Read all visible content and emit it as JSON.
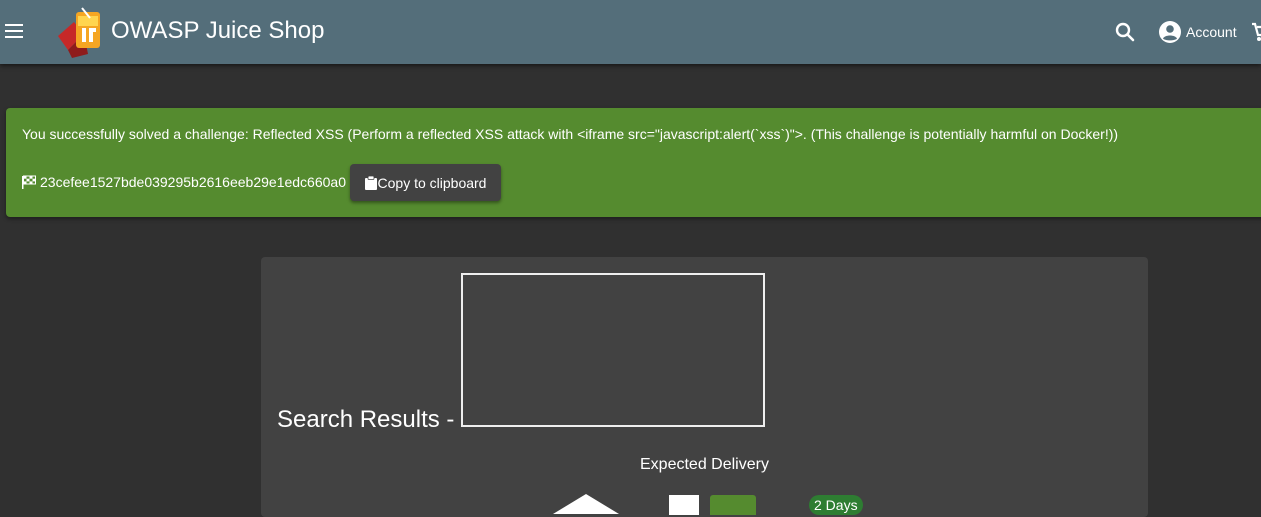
{
  "toolbar": {
    "app_title": "OWASP Juice Shop",
    "account_label": "Account",
    "icons": {
      "menu": "menu-icon",
      "search": "search-icon",
      "account": "account-circle-icon",
      "cart": "shopping-cart-icon"
    },
    "background_color": "#546e7a"
  },
  "banner": {
    "message": "You successfully solved a challenge: Reflected XSS (Perform a reflected XSS attack with <iframe src=\"javascript:alert(`xss`)\">. (This challenge is potentially harmful on Docker!))",
    "flag": "23cefee1527bde039295b2616eeb29e1edc660a0",
    "copy_label": "Copy to clipboard",
    "background_color": "#558b2f"
  },
  "search": {
    "title": "Search Results -",
    "delivery_label": "Expected Delivery",
    "days_badge": "2 Days"
  },
  "colors": {
    "page_background": "#303030",
    "card_background": "#424242",
    "accent_green": "#558b2f"
  }
}
